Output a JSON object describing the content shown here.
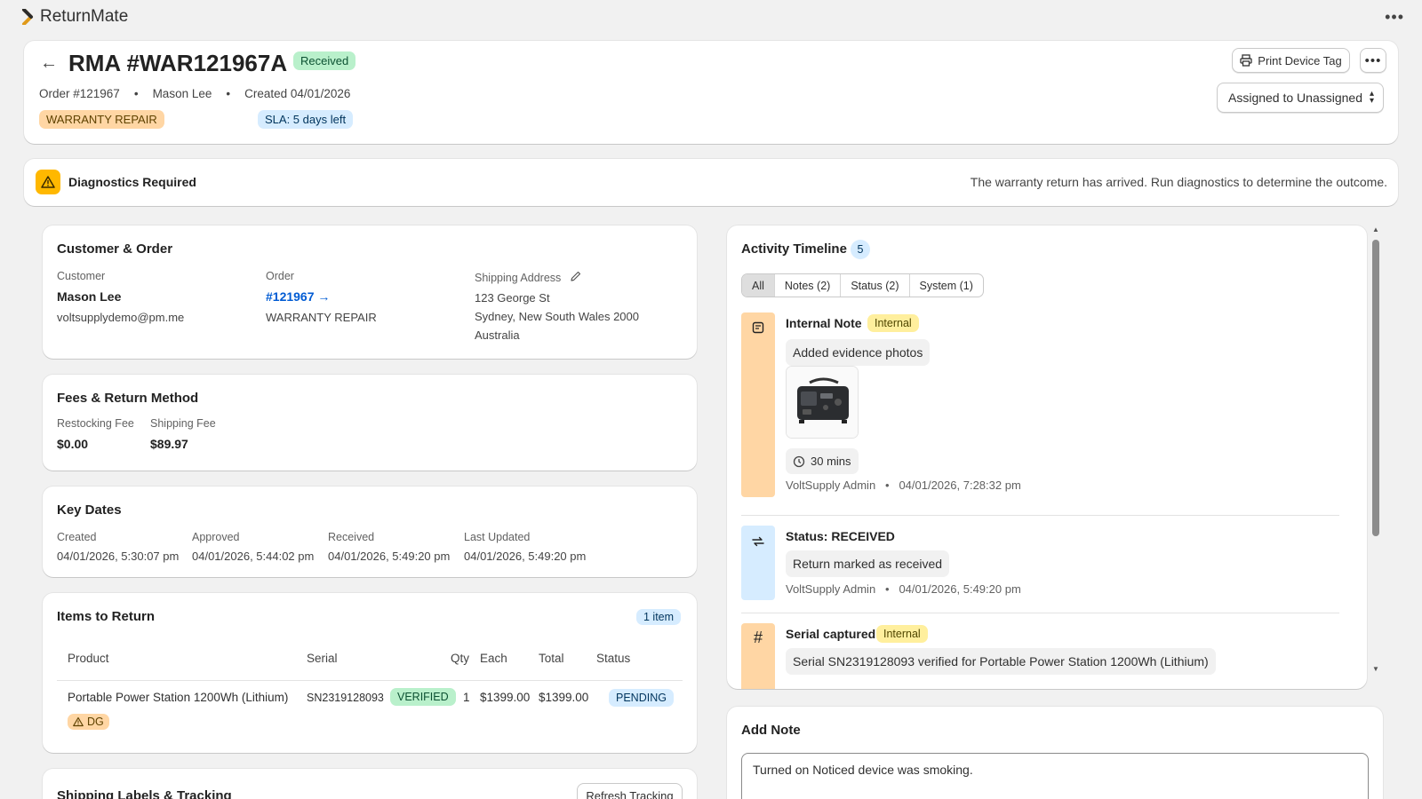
{
  "app": {
    "name": "ReturnMate",
    "more_icon": "ellipsis-icon"
  },
  "header": {
    "title": "RMA #WAR121967A",
    "status": "Received",
    "order": "Order #121967",
    "customer": "Mason Lee",
    "created": "Created 04/01/2026",
    "type_badge": "WARRANTY REPAIR",
    "sla_badge": "SLA: 5 days left",
    "print_label": "Print Device Tag",
    "assign_label": "Assigned to Unassigned"
  },
  "alert": {
    "title": "Diagnostics Required",
    "message": "The warranty return has arrived. Run diagnostics to determine the outcome."
  },
  "customer_order": {
    "title": "Customer & Order",
    "customer_label": "Customer",
    "customer_name": "Mason Lee",
    "customer_email": "voltsupplydemo@pm.me",
    "order_label": "Order",
    "order_link": "#121967 →",
    "order_type": "WARRANTY REPAIR",
    "address_label": "Shipping Address",
    "address_line1": "123 George St",
    "address_line2": "Sydney, New South Wales 2000",
    "address_line3": "Australia"
  },
  "fees": {
    "title": "Fees & Return Method",
    "restocking_label": "Restocking Fee",
    "restocking_value": "$0.00",
    "shipping_label": "Shipping Fee",
    "shipping_value": "$89.97"
  },
  "dates": {
    "title": "Key Dates",
    "created_label": "Created",
    "created_value": "04/01/2026, 5:30:07 pm",
    "approved_label": "Approved",
    "approved_value": "04/01/2026, 5:44:02 pm",
    "received_label": "Received",
    "received_value": "04/01/2026, 5:49:20 pm",
    "updated_label": "Last Updated",
    "updated_value": "04/01/2026, 5:49:20 pm"
  },
  "items": {
    "title": "Items to Return",
    "count": "1 item",
    "headers": {
      "product": "Product",
      "serial": "Serial",
      "qty": "Qty",
      "each": "Each",
      "total": "Total",
      "status": "Status"
    },
    "rows": [
      {
        "product": "Portable Power Station 1200Wh (Lithium)",
        "serial": "SN2319128093",
        "serial_badge": "VERIFIED",
        "qty": "1",
        "each": "$1399.00",
        "total": "$1399.00",
        "status": "PENDING",
        "dg_badge": "DG"
      }
    ]
  },
  "shipping": {
    "title": "Shipping Labels & Tracking",
    "refresh_label": "Refresh Tracking"
  },
  "activity": {
    "title": "Activity Timeline",
    "count": "5",
    "tabs": [
      "All",
      "Notes (2)",
      "Status (2)",
      "System (1)"
    ],
    "events": [
      {
        "title": "Internal Note",
        "badge": "Internal",
        "body": "Added evidence photos",
        "duration": "30 mins",
        "author": "VoltSupply Admin",
        "time": "04/01/2026, 7:28:32 pm",
        "color": "#ffd6a4"
      },
      {
        "title": "Status: RECEIVED",
        "body": "Return marked as received",
        "author": "VoltSupply Admin",
        "time": "04/01/2026, 5:49:20 pm",
        "color": "#d6ecff"
      },
      {
        "title": "Serial captured",
        "badge": "Internal",
        "body": "Serial SN2319128093 verified for Portable Power Station 1200Wh (Lithium)",
        "color": "#ffd6a4"
      }
    ]
  },
  "add_note": {
    "title": "Add Note",
    "value": "Turned on Noticed device was smoking."
  }
}
